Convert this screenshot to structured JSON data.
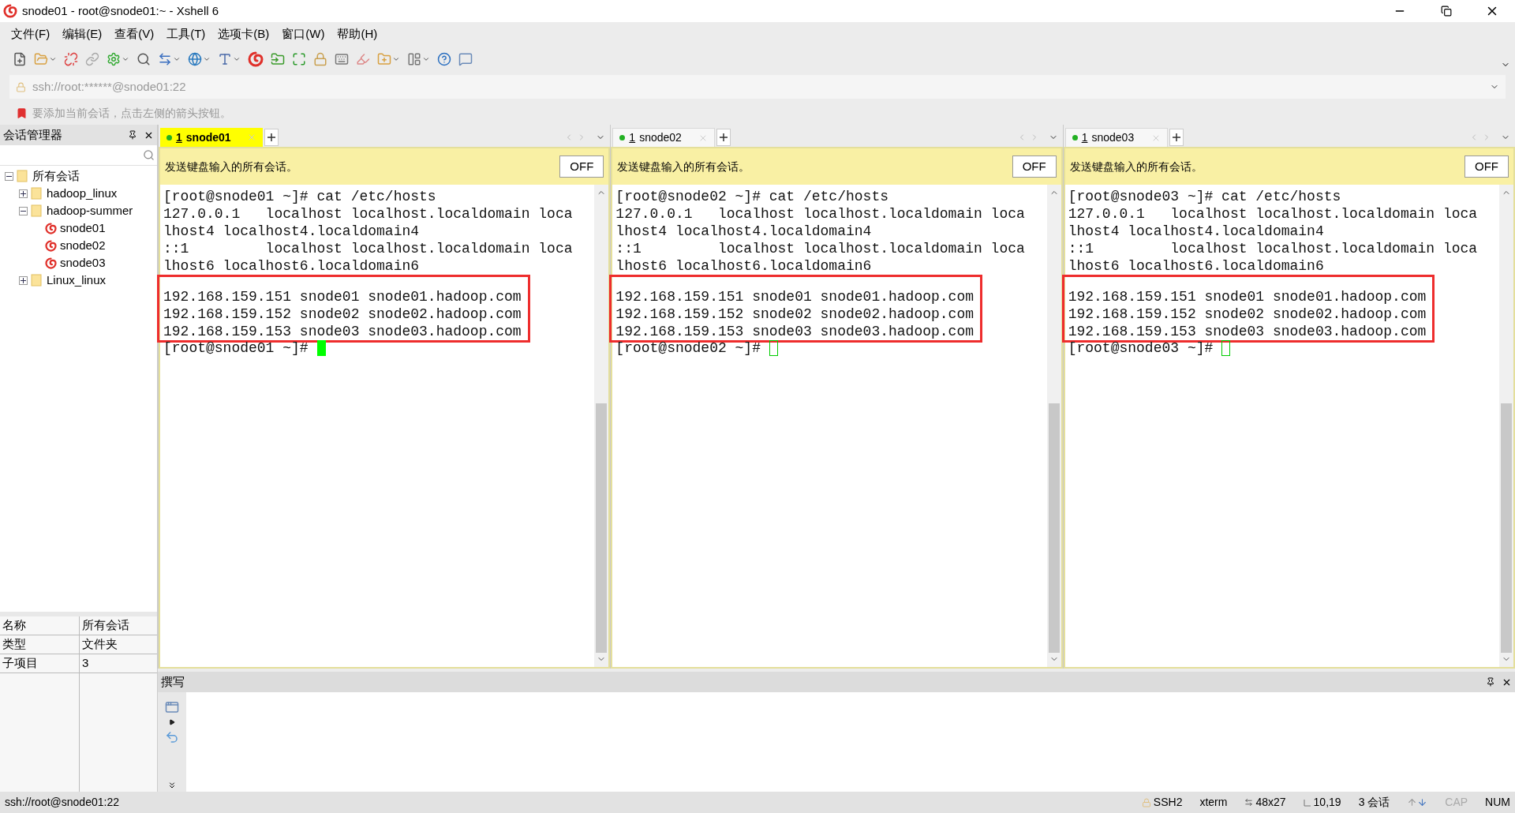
{
  "window": {
    "title": "snode01 - root@snode01:~ - Xshell 6"
  },
  "menu": [
    "文件(F)",
    "编辑(E)",
    "查看(V)",
    "工具(T)",
    "选项卡(B)",
    "窗口(W)",
    "帮助(H)"
  ],
  "address_bar": {
    "value": "ssh://root:******@snode01:22"
  },
  "hint_bar": {
    "text": "要添加当前会话，点击左侧的箭头按钮。"
  },
  "session_manager": {
    "title": "会话管理器",
    "tree": [
      {
        "label": "所有会话",
        "kind": "folder",
        "expanded": true,
        "children": [
          {
            "label": "hadoop_linux",
            "kind": "folder",
            "expanded": false
          },
          {
            "label": "hadoop-summer",
            "kind": "folder",
            "expanded": true,
            "children": [
              {
                "label": "snode01",
                "kind": "session"
              },
              {
                "label": "snode02",
                "kind": "session"
              },
              {
                "label": "snode03",
                "kind": "session"
              }
            ]
          },
          {
            "label": "Linux_linux",
            "kind": "folder",
            "expanded": false
          }
        ]
      }
    ],
    "properties": [
      {
        "name": "名称",
        "value": "所有会话"
      },
      {
        "name": "类型",
        "value": "文件夹"
      },
      {
        "name": "子项目",
        "value": "3"
      }
    ]
  },
  "panes": [
    {
      "tab": {
        "number": "1",
        "label": "snode01",
        "selected": true
      },
      "banner": "发送键盘输入的所有会话。",
      "off_button": "OFF",
      "lines": [
        "[root@snode01 ~]# cat /etc/hosts",
        "127.0.0.1   localhost localhost.localdomain loca",
        "lhost4 localhost4.localdomain4",
        "::1         localhost localhost.localdomain loca",
        "lhost6 localhost6.localdomain6"
      ],
      "highlighted_lines": [
        "192.168.159.151 snode01 snode01.hadoop.com",
        "192.168.159.152 snode02 snode02.hadoop.com",
        "192.168.159.153 snode03 snode03.hadoop.com"
      ],
      "prompt": "[root@snode01 ~]#"
    },
    {
      "tab": {
        "number": "1",
        "label": "snode02",
        "selected": false
      },
      "banner": "发送键盘输入的所有会话。",
      "off_button": "OFF",
      "lines": [
        "[root@snode02 ~]# cat /etc/hosts",
        "127.0.0.1   localhost localhost.localdomain loca",
        "lhost4 localhost4.localdomain4",
        "::1         localhost localhost.localdomain loca",
        "lhost6 localhost6.localdomain6"
      ],
      "highlighted_lines": [
        "192.168.159.151 snode01 snode01.hadoop.com",
        "192.168.159.152 snode02 snode02.hadoop.com",
        "192.168.159.153 snode03 snode03.hadoop.com"
      ],
      "prompt": "[root@snode02 ~]#"
    },
    {
      "tab": {
        "number": "1",
        "label": "snode03",
        "selected": false
      },
      "banner": "发送键盘输入的所有会话。",
      "off_button": "OFF",
      "lines": [
        "[root@snode03 ~]# cat /etc/hosts",
        "127.0.0.1   localhost localhost.localdomain loca",
        "lhost4 localhost4.localdomain4",
        "::1         localhost localhost.localdomain loca",
        "lhost6 localhost6.localdomain6"
      ],
      "highlighted_lines": [
        "192.168.159.151 snode01 snode01.hadoop.com",
        "192.168.159.152 snode02 snode02.hadoop.com",
        "192.168.159.153 snode03 snode03.hadoop.com"
      ],
      "prompt": "[root@snode03 ~]#"
    }
  ],
  "compose": {
    "title": "撰写"
  },
  "status_bar": {
    "connection": "ssh://root@snode01:22",
    "items": [
      {
        "kind": "lock",
        "text": "SSH2"
      },
      {
        "kind": "plain",
        "text": "xterm"
      },
      {
        "kind": "size",
        "text": "48x27"
      },
      {
        "kind": "position",
        "text": "10,19"
      },
      {
        "kind": "plain",
        "text": "3 会话"
      }
    ],
    "keys": [
      {
        "label": "CAP",
        "on": false
      },
      {
        "label": "NUM",
        "on": true
      }
    ]
  }
}
